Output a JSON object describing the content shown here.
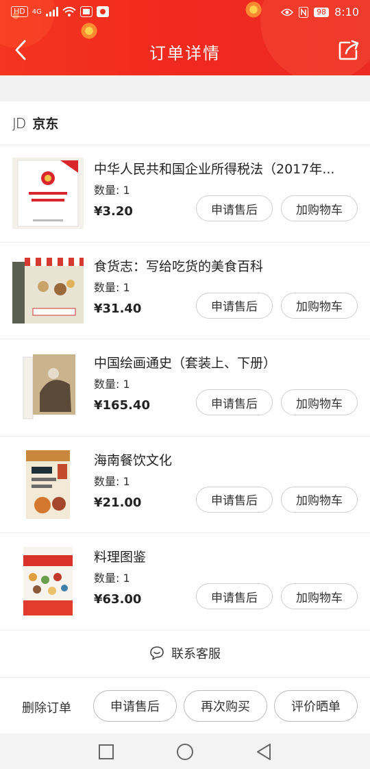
{
  "status_bar": {
    "hd_label": "HD",
    "network_label": "4G",
    "battery": "98",
    "time": "8:10"
  },
  "header": {
    "title": "订单详情",
    "bg_color": "#f0291f"
  },
  "store": {
    "logo": "JD",
    "name": "京东"
  },
  "items": [
    {
      "title": "中华人民共和国企业所得税法（2017年...",
      "qty": "数量: 1",
      "price": "¥3.20",
      "after_sales": "申请售后",
      "add_cart": "加购物车"
    },
    {
      "title": "食货志：写给吃货的美食百科",
      "qty": "数量: 1",
      "price": "¥31.40",
      "after_sales": "申请售后",
      "add_cart": "加购物车"
    },
    {
      "title": "中国绘画通史（套装上、下册）",
      "qty": "数量: 1",
      "price": "¥165.40",
      "after_sales": "申请售后",
      "add_cart": "加购物车"
    },
    {
      "title": "海南餐饮文化",
      "qty": "数量: 1",
      "price": "¥21.00",
      "after_sales": "申请售后",
      "add_cart": "加购物车"
    },
    {
      "title": "料理图鉴",
      "qty": "数量: 1",
      "price": "¥63.00",
      "after_sales": "申请售后",
      "add_cart": "加购物车"
    }
  ],
  "customer_service": {
    "label": "联系客服",
    "icon": "chat-icon"
  },
  "actions": {
    "delete": "删除订单",
    "after_sales": "申请售后",
    "rebuy": "再次购买",
    "review": "评价晒单"
  },
  "nav": {
    "recents_icon": "square-icon",
    "home_icon": "circle-icon",
    "back_icon": "triangle-back-icon"
  }
}
